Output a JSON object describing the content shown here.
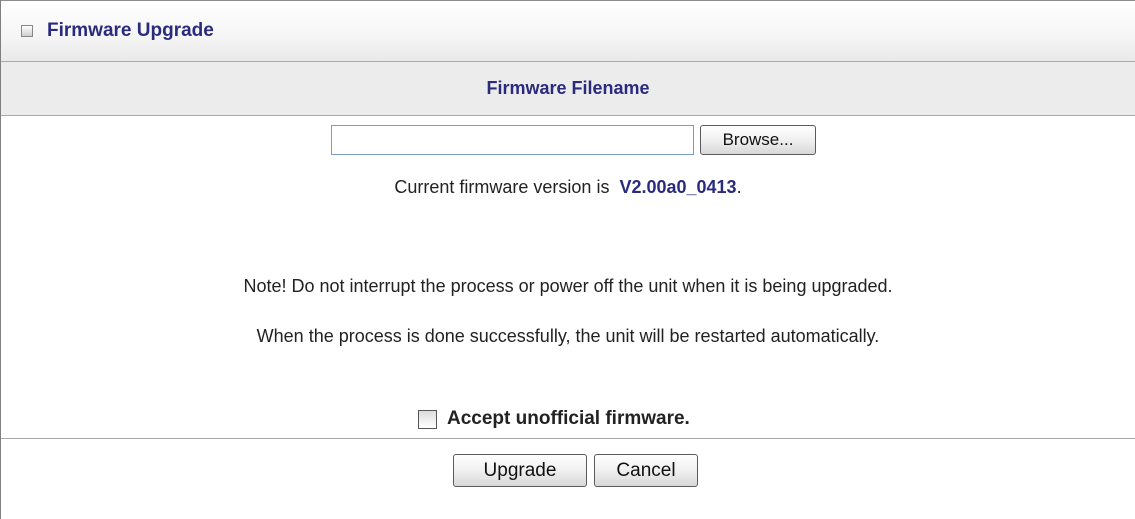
{
  "header": {
    "title": "Firmware Upgrade",
    "icon": "bullet-square-icon"
  },
  "section": {
    "title": "Firmware Filename"
  },
  "file": {
    "value": "",
    "placeholder": "",
    "browse_label": "Browse..."
  },
  "version": {
    "prefix": "Current firmware version is",
    "value": "V2.00a0_0413",
    "suffix": "."
  },
  "notes": {
    "line1": "Note! Do not interrupt the process or power off the unit when it is being upgraded.",
    "line2": "When the process is done successfully, the unit will be restarted automatically."
  },
  "accept": {
    "label": "Accept unofficial firmware.",
    "checked": false
  },
  "actions": {
    "upgrade_label": "Upgrade",
    "cancel_label": "Cancel"
  },
  "colors": {
    "accent_text": "#2b2b7e",
    "header_bg": "#ececec",
    "border": "#a9a9a9"
  }
}
